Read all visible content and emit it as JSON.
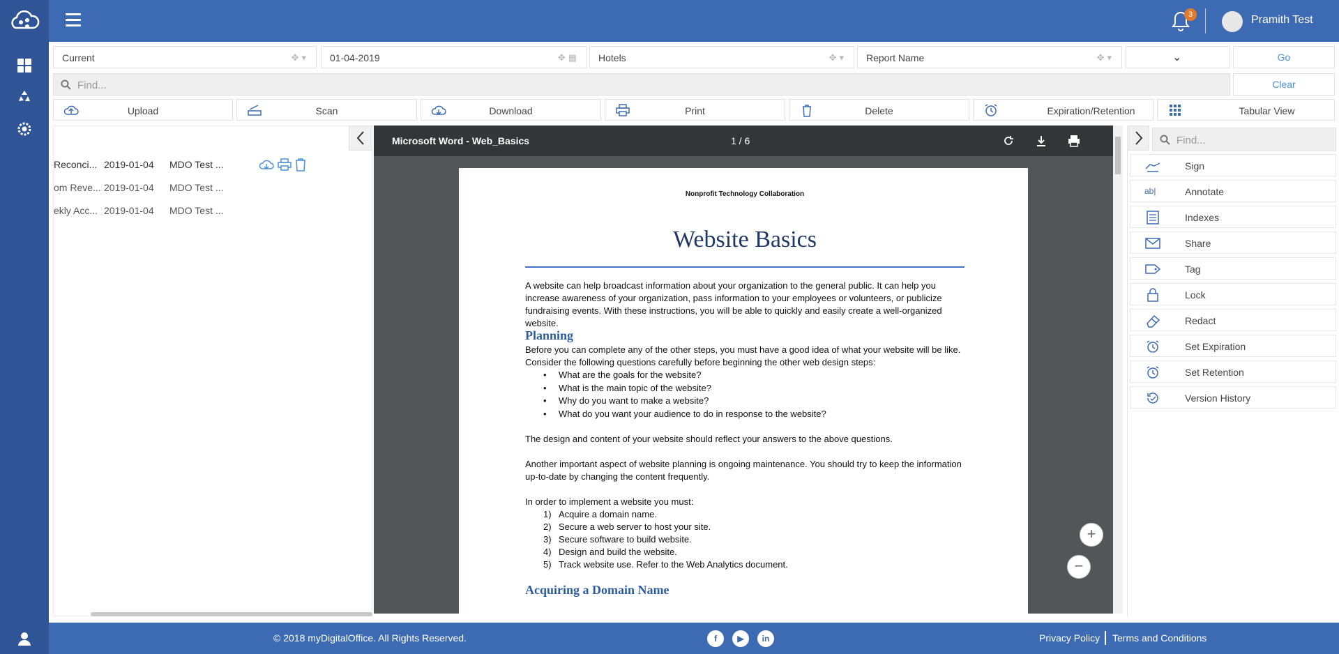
{
  "header": {
    "notification_count": "3",
    "user_name": "Pramith Test"
  },
  "filters": {
    "scope": "Current",
    "date": "01-04-2019",
    "category": "Hotels",
    "report": "Report Name",
    "extra": "",
    "go_label": "Go",
    "clear_label": "Clear",
    "find_placeholder": "Find..."
  },
  "actions": [
    {
      "label": "Upload",
      "icon": "cloud-upload-icon"
    },
    {
      "label": "Scan",
      "icon": "scanner-icon"
    },
    {
      "label": "Download",
      "icon": "cloud-download-icon"
    },
    {
      "label": "Print",
      "icon": "printer-icon"
    },
    {
      "label": "Delete",
      "icon": "trash-icon"
    },
    {
      "label": "Expiration/Retention",
      "icon": "alarm-clock-icon"
    },
    {
      "label": "Tabular View",
      "icon": "grid-icon"
    }
  ],
  "files": [
    {
      "name": "Reconci...",
      "date": "2019-01-04",
      "owner": "MDO Test ..."
    },
    {
      "name": "om Reve...",
      "date": "2019-01-04",
      "owner": "MDO Test ..."
    },
    {
      "name": "ekly Acc...",
      "date": "2019-01-04",
      "owner": "MDO Test ..."
    }
  ],
  "viewer": {
    "title": "Microsoft Word - Web_Basics",
    "page_indicator": "1 / 6"
  },
  "document": {
    "org": "Nonprofit Technology Collaboration",
    "title": "Website Basics",
    "intro": "A website can help broadcast information about your organization to the general public. It can help you increase awareness of your organization, pass information to your employees or volunteers, or publicize fundraising events. With these instructions, you will be able to quickly and easily create a well-organized website.",
    "planning_heading": "Planning",
    "planning_text": "Before you can complete any of the other steps, you must have a good idea of what your website will be like. Consider the following questions carefully before beginning the other web design steps:",
    "questions": [
      "What are the goals for the website?",
      "What is the main topic of the website?",
      "Why do you want to make a website?",
      "What do you want your audience to do in response to the website?"
    ],
    "reflect": "The design and content of your website should reflect your answers to the above questions.",
    "maintenance": "Another important aspect of website planning is ongoing maintenance. You should try to keep the information up-to-date by changing the content frequently.",
    "implement_intro": "In order to implement a website you must:",
    "steps": [
      "Acquire a domain name.",
      "Secure a web server to host your site.",
      "Secure software to build website.",
      "Design and build the website.",
      "Track website use. Refer to the Web Analytics document."
    ],
    "domain_heading": "Acquiring a Domain Name"
  },
  "tools": {
    "find_placeholder": "Find...",
    "items": [
      {
        "label": "Sign",
        "icon": "sign-hand-icon"
      },
      {
        "label": "Annotate",
        "icon": "text-cursor-icon"
      },
      {
        "label": "Indexes",
        "icon": "index-icon"
      },
      {
        "label": "Share",
        "icon": "envelope-icon"
      },
      {
        "label": "Tag",
        "icon": "tag-icon"
      },
      {
        "label": "Lock",
        "icon": "lock-icon"
      },
      {
        "label": "Redact",
        "icon": "eraser-icon"
      },
      {
        "label": "Set Expiration",
        "icon": "alarm-clock-icon"
      },
      {
        "label": "Set Retention",
        "icon": "alarm-clock-icon"
      },
      {
        "label": "Version History",
        "icon": "history-icon"
      }
    ]
  },
  "footer": {
    "copyright": "© 2018 myDigitalOffice. All Rights Reserved.",
    "privacy": "Privacy Policy",
    "terms": "Terms and Conditions",
    "social": [
      "f",
      "▶",
      "in"
    ]
  },
  "colors": {
    "nav": "#2f5597",
    "topbar": "#3d6bb3",
    "accent": "#4a90d9",
    "badge": "#e07b2b",
    "viewer_bg": "#525659"
  }
}
